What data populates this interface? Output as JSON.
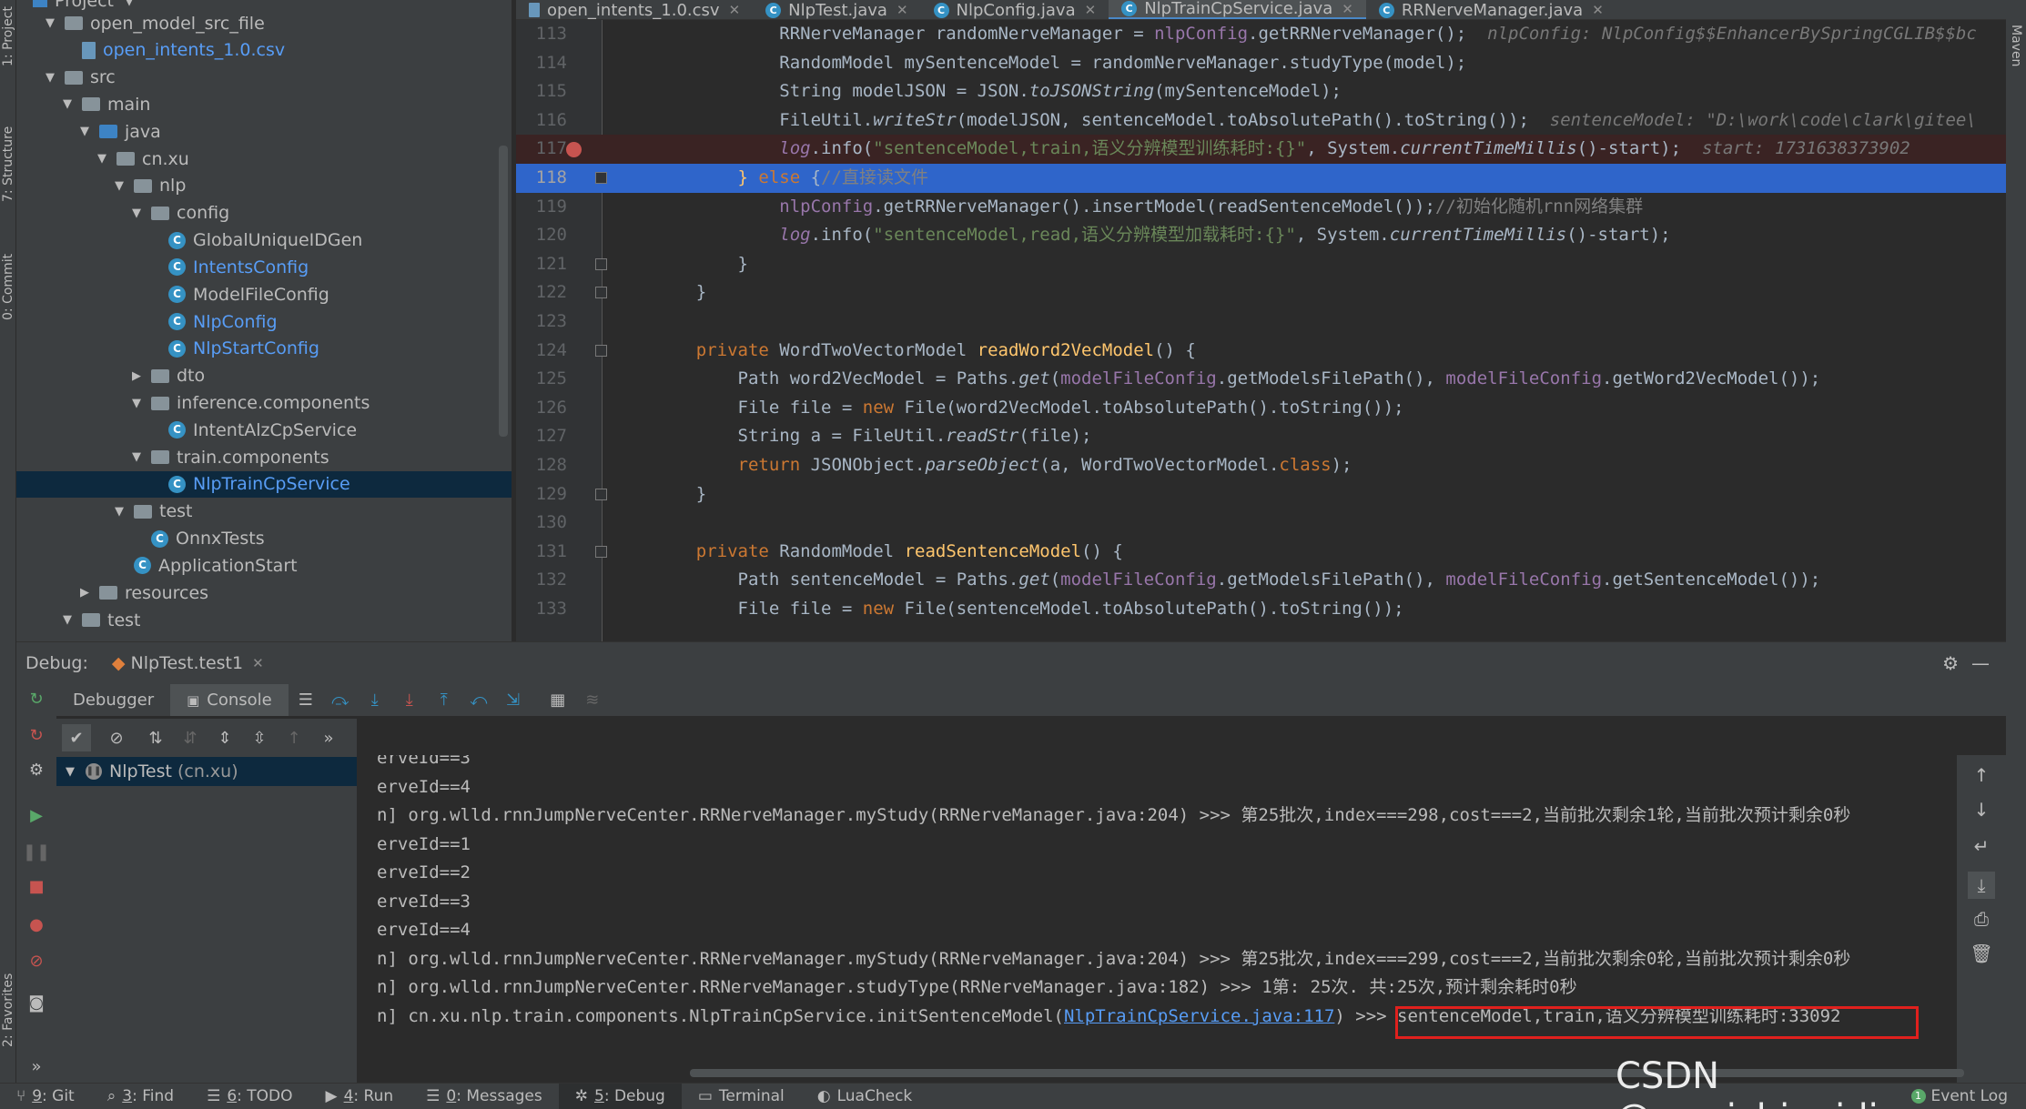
{
  "side_tabs": {
    "project": "1: Project",
    "structure": "7: Structure",
    "commit": "0: Commit",
    "favorites": "2: Favorites",
    "maven": "Maven"
  },
  "project": {
    "title": "Project",
    "tree": [
      {
        "label": "open_model_src_file",
        "type": "folder",
        "indent": 1,
        "arrow": "▼"
      },
      {
        "label": "open_intents_1.0.csv",
        "type": "file",
        "indent": 2,
        "arrow": "",
        "blue": true
      },
      {
        "label": "src",
        "type": "folder",
        "indent": 1,
        "arrow": "▼"
      },
      {
        "label": "main",
        "type": "folder",
        "indent": 2,
        "arrow": "▼"
      },
      {
        "label": "java",
        "type": "folder-blue",
        "indent": 3,
        "arrow": "▼"
      },
      {
        "label": "cn.xu",
        "type": "folder",
        "indent": 4,
        "arrow": "▼"
      },
      {
        "label": "nlp",
        "type": "folder",
        "indent": 5,
        "arrow": "▼"
      },
      {
        "label": "config",
        "type": "folder",
        "indent": 6,
        "arrow": "▼"
      },
      {
        "label": "GlobalUniqueIDGen",
        "type": "class",
        "indent": 7,
        "arrow": ""
      },
      {
        "label": "IntentsConfig",
        "type": "class",
        "indent": 7,
        "arrow": "",
        "blue": true
      },
      {
        "label": "ModelFileConfig",
        "type": "class",
        "indent": 7,
        "arrow": ""
      },
      {
        "label": "NlpConfig",
        "type": "class",
        "indent": 7,
        "arrow": "",
        "blue": true
      },
      {
        "label": "NlpStartConfig",
        "type": "class",
        "indent": 7,
        "arrow": "",
        "blue": true
      },
      {
        "label": "dto",
        "type": "folder",
        "indent": 6,
        "arrow": "▶"
      },
      {
        "label": "inference.components",
        "type": "folder",
        "indent": 6,
        "arrow": "▼"
      },
      {
        "label": "IntentAlzCpService",
        "type": "class",
        "indent": 7,
        "arrow": ""
      },
      {
        "label": "train.components",
        "type": "folder",
        "indent": 6,
        "arrow": "▼"
      },
      {
        "label": "NlpTrainCpService",
        "type": "class",
        "indent": 7,
        "arrow": "",
        "blue": true,
        "selected": true
      },
      {
        "label": "test",
        "type": "folder",
        "indent": 5,
        "arrow": "▼"
      },
      {
        "label": "OnnxTests",
        "type": "class",
        "indent": 6,
        "arrow": ""
      },
      {
        "label": "ApplicationStart",
        "type": "class",
        "indent": 5,
        "arrow": ""
      },
      {
        "label": "resources",
        "type": "folder",
        "indent": 3,
        "arrow": "▶"
      },
      {
        "label": "test",
        "type": "folder",
        "indent": 2,
        "arrow": "▼"
      }
    ]
  },
  "editor_tabs": [
    {
      "label": "open_intents_1.0.csv",
      "active": false
    },
    {
      "label": "NlpTest.java",
      "active": false
    },
    {
      "label": "NlpConfig.java",
      "active": false
    },
    {
      "label": "NlpTrainCpService.java",
      "active": true
    },
    {
      "label": "RRNerveManager.java",
      "active": false
    }
  ],
  "code": [
    {
      "n": "113",
      "html": "            RRNerveManager randomNerveManager = <span class=\"f\">nlpConfig</span>.getRRNerveManager();  <span class=\"hint\">nlpConfig: NlpConfig$$EnhancerBySpringCGLIB$$bc</span>"
    },
    {
      "n": "114",
      "html": "            RandomModel mySentenceModel = randomNerveManager.studyType(model);"
    },
    {
      "n": "115",
      "html": "            String modelJSON = JSON.<span class=\"i\">toJSONString</span>(mySentenceModel);"
    },
    {
      "n": "116",
      "html": "            FileUtil.<span class=\"i\">writeStr</span>(modelJSON, sentenceModel.toAbsolutePath().toString());  <span class=\"hint\">sentenceModel: \"D:\\work\\code\\clark\\gitee\\</span>"
    },
    {
      "n": "117",
      "html": "            <span class=\"f i\">log</span>.info(<span class=\"s\">\"sentenceModel,train,语义分辨模型训练耗时:{}\"</span>, System.<span class=\"i\">currentTimeMillis</span>()-start);  <span class=\"hint\">start: 1731638373902</span>",
      "bp": true
    },
    {
      "n": "118",
      "html": "        <span class=\"m\">}</span> <span class=\"k\">else</span> {<span class=\"c\">//直接读文件</span>",
      "current": true
    },
    {
      "n": "119",
      "html": "            <span class=\"f\">nlpConfig</span>.getRRNerveManager().insertModel(readSentenceModel());<span class=\"c\">//初始化随机rnn网络集群</span>"
    },
    {
      "n": "120",
      "html": "            <span class=\"f i\">log</span>.info(<span class=\"s\">\"sentenceModel,read,语义分辨模型加载耗时:{}\"</span>, System.<span class=\"i\">currentTimeMillis</span>()-start);"
    },
    {
      "n": "121",
      "html": "        }"
    },
    {
      "n": "122",
      "html": "    }"
    },
    {
      "n": "123",
      "html": ""
    },
    {
      "n": "124",
      "html": "    <span class=\"k\">private</span> WordTwoVectorModel <span class=\"m\">readWord2VecModel</span>() {"
    },
    {
      "n": "125",
      "html": "        Path word2VecModel = Paths.<span class=\"i\">get</span>(<span class=\"f\">modelFileConfig</span>.getModelsFilePath(), <span class=\"f\">modelFileConfig</span>.getWord2VecModel());"
    },
    {
      "n": "126",
      "html": "        File file = <span class=\"k\">new</span> File(word2VecModel.toAbsolutePath().toString());"
    },
    {
      "n": "127",
      "html": "        String a = FileUtil.<span class=\"i\">readStr</span>(file);"
    },
    {
      "n": "128",
      "html": "        <span class=\"k\">return</span> JSONObject.<span class=\"i\">parseObject</span>(a, WordTwoVectorModel.<span class=\"k\">class</span>);"
    },
    {
      "n": "129",
      "html": "    }"
    },
    {
      "n": "130",
      "html": ""
    },
    {
      "n": "131",
      "html": "    <span class=\"k\">private</span> RandomModel <span class=\"m\">readSentenceModel</span>() {"
    },
    {
      "n": "132",
      "html": "        Path sentenceModel = Paths.<span class=\"i\">get</span>(<span class=\"f\">modelFileConfig</span>.getModelsFilePath(), <span class=\"f\">modelFileConfig</span>.getSentenceModel());"
    },
    {
      "n": "133",
      "html": "        File file = <span class=\"k\">new</span> File(sentenceModel.toAbsolutePath().toString());"
    }
  ],
  "debug": {
    "label": "Debug:",
    "session": "NlpTest.test1",
    "tab_debugger": "Debugger",
    "tab_console": "Console",
    "frame": "NlpTest",
    "frame_pkg": "(cn.xu)"
  },
  "console_lines": [
    "erveId==3",
    "erveId==4",
    "n] org.wlld.rnnJumpNerveCenter.RRNerveManager.myStudy(RRNerveManager.java:204) >>> 第25批次,index===298,cost===2,当前批次剩余1轮,当前批次预计剩余0秒",
    "erveId==1",
    "erveId==2",
    "erveId==3",
    "erveId==4",
    "n] org.wlld.rnnJumpNerveCenter.RRNerveManager.myStudy(RRNerveManager.java:204) >>> 第25批次,index===299,cost===2,当前批次剩余0轮,当前批次预计剩余0秒",
    "n] org.wlld.rnnJumpNerveCenter.RRNerveManager.studyType(RRNerveManager.java:182) >>> 1第: 25次. 共:25次,预计剩余耗时0秒"
  ],
  "console_last": {
    "prefix": "n] cn.xu.nlp.train.components.NlpTrainCpService.initSentenceModel(",
    "link": "NlpTrainCpService.java:117",
    "suffix": ") ",
    "highlight": ">>> sentenceModel,train,语义分辨模型训练耗时:33092"
  },
  "bottom_bar": [
    {
      "key": "9",
      "label": ": Git",
      "icon": "git-icon"
    },
    {
      "key": "3",
      "label": ": Find",
      "icon": "find-icon"
    },
    {
      "key": "6",
      "label": ": TODO",
      "icon": "todo-icon"
    },
    {
      "key": "4",
      "label": ": Run",
      "icon": "run-icon"
    },
    {
      "key": "0",
      "label": ": Messages",
      "icon": "messages-icon"
    },
    {
      "key": "5",
      "label": ": Debug",
      "icon": "debug-icon",
      "active": true
    },
    {
      "key": "",
      "label": "Terminal",
      "icon": "terminal-icon"
    },
    {
      "key": "",
      "label": "LuaCheck",
      "icon": "lua-icon"
    }
  ],
  "event_log": {
    "count": "1",
    "label": "Event Log"
  },
  "watermark": "CSDN @woaichinaidiao"
}
